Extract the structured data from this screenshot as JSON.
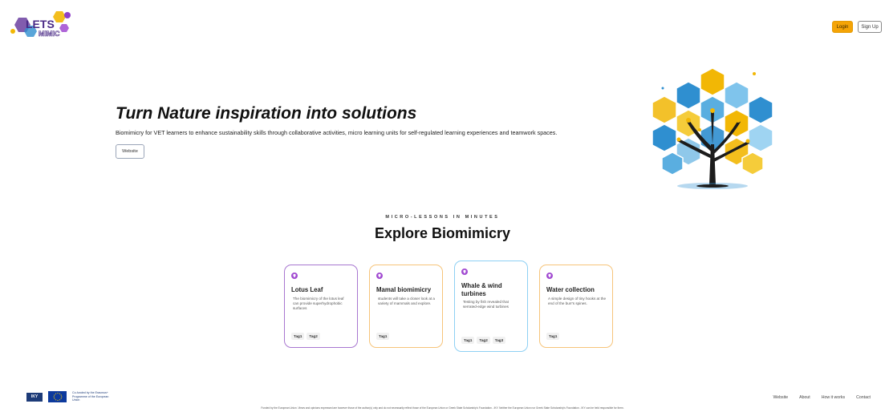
{
  "header": {
    "logo_text": "LETS MIMIC",
    "login_label": "Login",
    "signup_label": "Sign Up"
  },
  "hero": {
    "title": "Turn Nature inspiration into solutions",
    "description": "Biomimicry for VET learners to enhance sustainability skills through collaborative activities, micro learning units for self-regulated learning experiences and teamwork spaces.",
    "website_button": "Website",
    "illustration": "hexagon-tree-illustration"
  },
  "explore": {
    "eyebrow": "MICRO-LESSONS IN MINUTES",
    "title": "Explore Biomimicry",
    "cards": [
      {
        "title": "Lotus Leaf",
        "description": "The biomimicry of the lotus leaf can provide superhydrophobic surfaces",
        "tags": [
          "Tag1",
          "Tag2"
        ],
        "border_color": "#a877d0"
      },
      {
        "title": "Mamal biomimicry",
        "description": "students will take a closer look at a variety of mammals and explore.",
        "tags": [
          "Tag1"
        ],
        "border_color": "#f6c47a"
      },
      {
        "title": "Whale & wind turbines",
        "description": "Testing by fish revealed that serrated-edge wind turbines",
        "tags": [
          "Tag1",
          "Tag2",
          "Tag3"
        ],
        "border_color": "#8ed0f4"
      },
      {
        "title": "Water collection",
        "description": "A simple design of tiny hooks at the end of the burr's spines.",
        "tags": [
          "Tag1"
        ],
        "border_color": "#f6c47a"
      }
    ],
    "card_icon": "lightbulb-icon"
  },
  "footer": {
    "iky_label": "IKY",
    "eu_label": "Co-funded by the Erasmus+ Programme of the European Union",
    "nav": [
      "Website",
      "About",
      "How it works",
      "Contact"
    ],
    "disclaimer": "Funded by the European Union. Views and opinions expressed are however those of the author(s) only and do not necessarily reflect those of the European Union or Greek State Scholarship's Foundation - IKY. Neither the European Union nor Greek State Scholarship's Foundation - IKY can be held responsible for them."
  },
  "colors": {
    "login": "#f5a406",
    "accent_purple": "#a14ad1",
    "hex_yellow": "#f2b705",
    "hex_blue": "#2f8fd0"
  }
}
